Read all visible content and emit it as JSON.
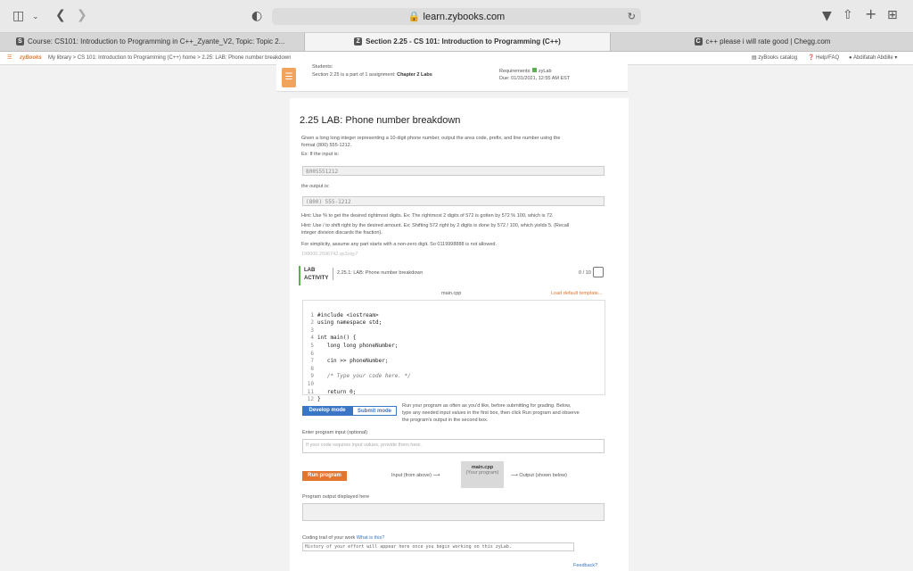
{
  "browser": {
    "url": "learn.zybooks.com",
    "icons": {
      "sidebar": "sidebar-icon",
      "back": "back-arrow-icon",
      "forward": "forward-arrow-icon",
      "shield": "shield-icon",
      "lock": "lock-icon",
      "reload": "reload-icon",
      "download": "download-icon",
      "share": "share-icon",
      "plus": "plus-icon",
      "grid": "grid-icon"
    },
    "tabs": [
      {
        "label": "Course: CS101: Introduction to Programming in C++_Zyante_V2, Topic: Topic 2...",
        "favicon": "S"
      },
      {
        "label": "Section 2.25 - CS 101: Introduction to Programming (C++)",
        "favicon": "Z"
      },
      {
        "label": "c++ please i will rate good | Chegg.com",
        "favicon": "C"
      }
    ]
  },
  "nav": {
    "brand": "zyBooks",
    "breadcrumb": "My library > CS 101: Introduction to Programming (C++) home > 2.25: LAB: Phone number breakdown",
    "catalog": "zyBooks catalog",
    "help": "Help/FAQ",
    "user": "Abdifatah Abdille"
  },
  "summary": {
    "students": "Students:",
    "section_text": "Section 2.25 is a part of 1 assignment:",
    "assignment": "Chapter 2 Labs",
    "requirements": "Requirements:",
    "req_value": "zyLab",
    "due": "Due: 01/31/2021, 12:55 AM EST"
  },
  "lab": {
    "title": "2.25 LAB: Phone number breakdown",
    "desc1": "Given a long long integer representing a 10-digit phone number, output the area code, prefix, and line number using the",
    "desc2": "format (800) 555-1212.",
    "ex_input_label": "Ex: If the input is:",
    "ex_input": "8005551212",
    "ex_output_label": "the output is:",
    "ex_output": "(800) 555-1212",
    "hint1": "Hint: Use % to get the desired rightmost digits. Ex: The rightmost 2 digits of 572 is gotten by 572 % 100, which is 72.",
    "hint2": "Hint: Use / to shift right by the desired amount. Ex: Shifting 572 right by 2 digits is done by 572 / 100, which yields 5. (Recall",
    "hint3": "integer division discards the fraction).",
    "simplicity": "For simplicity, assume any part starts with a non-zero digit. So 0119998888 is not allowed.",
    "id_line": "190000.2696742.qx3zqy7",
    "activity_tag1": "LAB",
    "activity_tag2": "ACTIVITY",
    "activity_title": "2.25.1: LAB: Phone number breakdown",
    "score": "0 / 10",
    "filename": "main.cpp",
    "load_template": "Load default template...",
    "code_lines": [
      "#include <iostream>",
      "using namespace std;",
      "",
      "int main() {",
      "   long long phoneNumber;",
      "",
      "   cin >> phoneNumber;",
      "",
      "   /* Type your code here. */",
      "",
      "   return 0;",
      "}"
    ],
    "line_numbers": [
      "1",
      "2",
      "3",
      "4",
      "5",
      "6",
      "7",
      "8",
      "9",
      "10",
      "11",
      "12"
    ],
    "develop_mode": "Develop mode",
    "submit_mode": "Submit mode",
    "mode_desc1": "Run your program as often as you'd like, before submitting for grading. Below,",
    "mode_desc2": "type any needed input values in the first box, then click Run program and observe",
    "mode_desc3": "the program's output in the second box.",
    "input_label": "Enter program input (optional)",
    "input_placeholder": "If your code requires input values, provide them here.",
    "run_program": "Run program",
    "input_from": "Input (from above)",
    "main_cpp": "main.cpp",
    "your_program": "(Your program)",
    "output_shown": "Output (shown below)",
    "output_label": "Program output displayed here",
    "coding_trail": "Coding trail of your work",
    "what_is_this": "What is this?",
    "history": "History of your effort will appear here once you begin working on this zyLab.",
    "feedback": "Feedback?"
  }
}
